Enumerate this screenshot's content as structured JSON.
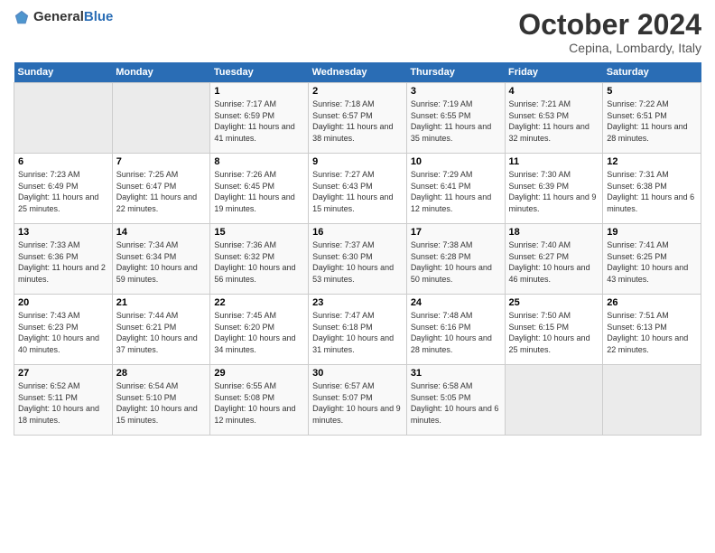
{
  "header": {
    "logo_general": "General",
    "logo_blue": "Blue",
    "title": "October 2024",
    "subtitle": "Cepina, Lombardy, Italy"
  },
  "calendar": {
    "days_of_week": [
      "Sunday",
      "Monday",
      "Tuesday",
      "Wednesday",
      "Thursday",
      "Friday",
      "Saturday"
    ],
    "weeks": [
      [
        {
          "day": "",
          "info": ""
        },
        {
          "day": "",
          "info": ""
        },
        {
          "day": "1",
          "info": "Sunrise: 7:17 AM\nSunset: 6:59 PM\nDaylight: 11 hours and 41 minutes."
        },
        {
          "day": "2",
          "info": "Sunrise: 7:18 AM\nSunset: 6:57 PM\nDaylight: 11 hours and 38 minutes."
        },
        {
          "day": "3",
          "info": "Sunrise: 7:19 AM\nSunset: 6:55 PM\nDaylight: 11 hours and 35 minutes."
        },
        {
          "day": "4",
          "info": "Sunrise: 7:21 AM\nSunset: 6:53 PM\nDaylight: 11 hours and 32 minutes."
        },
        {
          "day": "5",
          "info": "Sunrise: 7:22 AM\nSunset: 6:51 PM\nDaylight: 11 hours and 28 minutes."
        }
      ],
      [
        {
          "day": "6",
          "info": "Sunrise: 7:23 AM\nSunset: 6:49 PM\nDaylight: 11 hours and 25 minutes."
        },
        {
          "day": "7",
          "info": "Sunrise: 7:25 AM\nSunset: 6:47 PM\nDaylight: 11 hours and 22 minutes."
        },
        {
          "day": "8",
          "info": "Sunrise: 7:26 AM\nSunset: 6:45 PM\nDaylight: 11 hours and 19 minutes."
        },
        {
          "day": "9",
          "info": "Sunrise: 7:27 AM\nSunset: 6:43 PM\nDaylight: 11 hours and 15 minutes."
        },
        {
          "day": "10",
          "info": "Sunrise: 7:29 AM\nSunset: 6:41 PM\nDaylight: 11 hours and 12 minutes."
        },
        {
          "day": "11",
          "info": "Sunrise: 7:30 AM\nSunset: 6:39 PM\nDaylight: 11 hours and 9 minutes."
        },
        {
          "day": "12",
          "info": "Sunrise: 7:31 AM\nSunset: 6:38 PM\nDaylight: 11 hours and 6 minutes."
        }
      ],
      [
        {
          "day": "13",
          "info": "Sunrise: 7:33 AM\nSunset: 6:36 PM\nDaylight: 11 hours and 2 minutes."
        },
        {
          "day": "14",
          "info": "Sunrise: 7:34 AM\nSunset: 6:34 PM\nDaylight: 10 hours and 59 minutes."
        },
        {
          "day": "15",
          "info": "Sunrise: 7:36 AM\nSunset: 6:32 PM\nDaylight: 10 hours and 56 minutes."
        },
        {
          "day": "16",
          "info": "Sunrise: 7:37 AM\nSunset: 6:30 PM\nDaylight: 10 hours and 53 minutes."
        },
        {
          "day": "17",
          "info": "Sunrise: 7:38 AM\nSunset: 6:28 PM\nDaylight: 10 hours and 50 minutes."
        },
        {
          "day": "18",
          "info": "Sunrise: 7:40 AM\nSunset: 6:27 PM\nDaylight: 10 hours and 46 minutes."
        },
        {
          "day": "19",
          "info": "Sunrise: 7:41 AM\nSunset: 6:25 PM\nDaylight: 10 hours and 43 minutes."
        }
      ],
      [
        {
          "day": "20",
          "info": "Sunrise: 7:43 AM\nSunset: 6:23 PM\nDaylight: 10 hours and 40 minutes."
        },
        {
          "day": "21",
          "info": "Sunrise: 7:44 AM\nSunset: 6:21 PM\nDaylight: 10 hours and 37 minutes."
        },
        {
          "day": "22",
          "info": "Sunrise: 7:45 AM\nSunset: 6:20 PM\nDaylight: 10 hours and 34 minutes."
        },
        {
          "day": "23",
          "info": "Sunrise: 7:47 AM\nSunset: 6:18 PM\nDaylight: 10 hours and 31 minutes."
        },
        {
          "day": "24",
          "info": "Sunrise: 7:48 AM\nSunset: 6:16 PM\nDaylight: 10 hours and 28 minutes."
        },
        {
          "day": "25",
          "info": "Sunrise: 7:50 AM\nSunset: 6:15 PM\nDaylight: 10 hours and 25 minutes."
        },
        {
          "day": "26",
          "info": "Sunrise: 7:51 AM\nSunset: 6:13 PM\nDaylight: 10 hours and 22 minutes."
        }
      ],
      [
        {
          "day": "27",
          "info": "Sunrise: 6:52 AM\nSunset: 5:11 PM\nDaylight: 10 hours and 18 minutes."
        },
        {
          "day": "28",
          "info": "Sunrise: 6:54 AM\nSunset: 5:10 PM\nDaylight: 10 hours and 15 minutes."
        },
        {
          "day": "29",
          "info": "Sunrise: 6:55 AM\nSunset: 5:08 PM\nDaylight: 10 hours and 12 minutes."
        },
        {
          "day": "30",
          "info": "Sunrise: 6:57 AM\nSunset: 5:07 PM\nDaylight: 10 hours and 9 minutes."
        },
        {
          "day": "31",
          "info": "Sunrise: 6:58 AM\nSunset: 5:05 PM\nDaylight: 10 hours and 6 minutes."
        },
        {
          "day": "",
          "info": ""
        },
        {
          "day": "",
          "info": ""
        }
      ]
    ]
  }
}
